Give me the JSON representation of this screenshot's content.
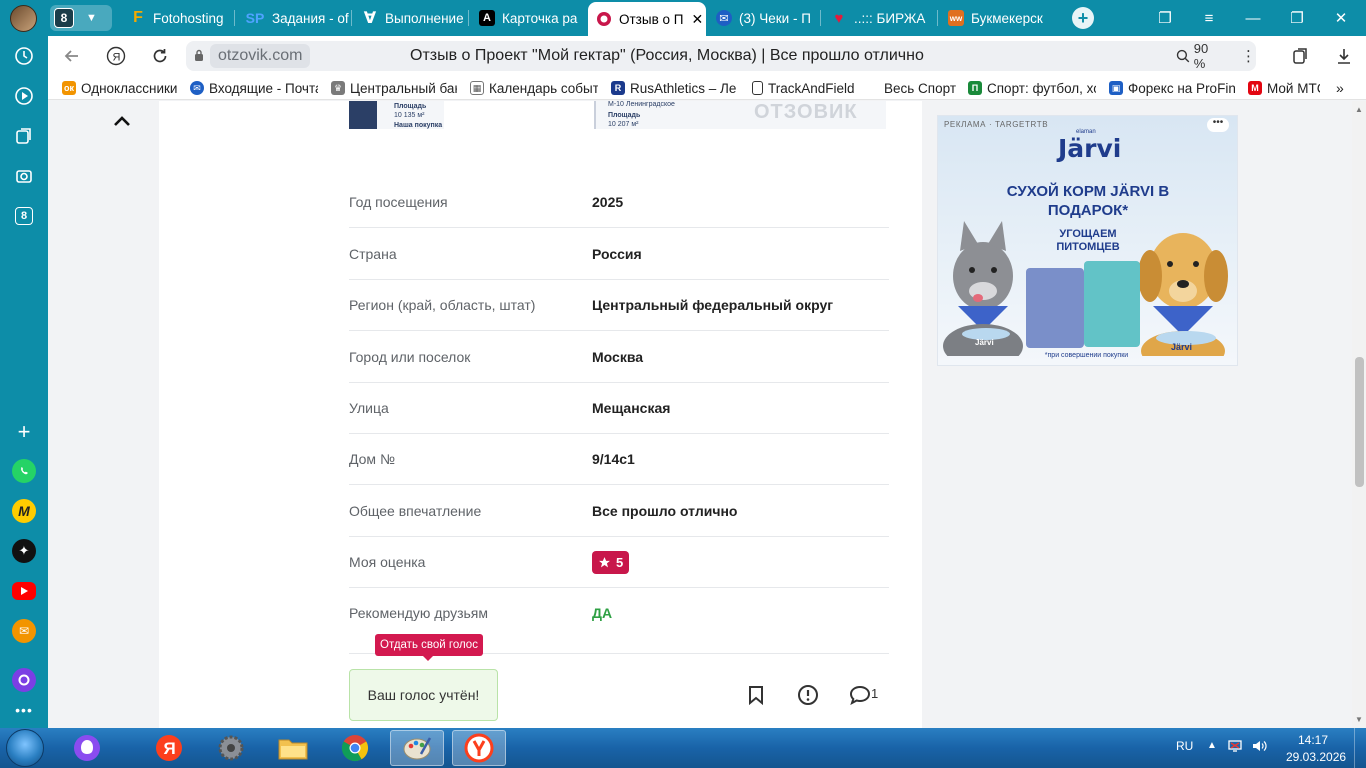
{
  "browser": {
    "tab_count": "8",
    "tabs": [
      {
        "label": "Fotohosting",
        "icon_letter": "F",
        "icon_color": "#f2a900"
      },
      {
        "label": "Задания - of",
        "icon_letter": "SP",
        "icon_color": "#1b74e4"
      },
      {
        "label": "Выполнение",
        "icon_letter": "∀",
        "icon_color": "#ffffff"
      },
      {
        "label": "Карточка ра",
        "icon_letter": "A",
        "icon_color": "#000000"
      },
      {
        "label": "Отзыв о П",
        "icon_letter": "",
        "icon_color": "#c8174b"
      },
      {
        "label": "(3) Чеки - П",
        "icon_letter": "✉",
        "icon_color": "#1e5fc4"
      },
      {
        "label": "..::: БИРЖА",
        "icon_letter": "♥",
        "icon_color": "#e21b3c"
      },
      {
        "label": "Букмекерск",
        "icon_letter": "ww",
        "icon_color": "#e07020"
      }
    ],
    "address": {
      "domain": "otzovik.com",
      "title": "Отзыв о Проект \"Мой гектар\" (Россия, Москва) | Все прошло отлично",
      "zoom": "90 %"
    },
    "bookmarks": [
      {
        "label": "Одноклассники",
        "color": "#f29400",
        "letter": "ок"
      },
      {
        "label": "Входящие - Почта",
        "color": "#1e5fc4",
        "letter": "✉"
      },
      {
        "label": "Центральный бан",
        "color": "#7a7a7a",
        "letter": "♛"
      },
      {
        "label": "Календарь событ",
        "color": "#555555",
        "letter": "▦"
      },
      {
        "label": "RusAthletics – Ле",
        "color": "#1b3a8c",
        "letter": "R"
      },
      {
        "label": "TrackAndField",
        "color": "#ffffff",
        "letter": "▯"
      },
      {
        "label": "Весь Спорт",
        "color": "#ffffff",
        "letter": ""
      },
      {
        "label": "Спорт: футбол, хо",
        "color": "#1a8a3a",
        "letter": "П"
      },
      {
        "label": "Форекс на ProFina",
        "color": "#1e5fc4",
        "letter": "▣"
      },
      {
        "label": "Мой МТС",
        "color": "#e30611",
        "letter": "М"
      }
    ]
  },
  "review": {
    "thumb1_lines": [
      "Площадь",
      "10 135 м²",
      "Наша покупка"
    ],
    "thumb2_lines": [
      "М-10 Ленинградское",
      "Площадь",
      "10 207 м²"
    ],
    "watermark": "ОТЗОВИК",
    "fields": [
      {
        "label": "Год посещения",
        "value": "2025"
      },
      {
        "label": "Страна",
        "value": "Россия"
      },
      {
        "label": "Регион (край, область, штат)",
        "value": "Центральный федеральный округ"
      },
      {
        "label": "Город или поселок",
        "value": "Москва"
      },
      {
        "label": "Улица",
        "value": "Мещанская"
      },
      {
        "label": "Дом №",
        "value": "9/14с1"
      },
      {
        "label": "Общее впечатление",
        "value": "Все прошло отлично"
      },
      {
        "label": "Моя оценка",
        "value": "5"
      },
      {
        "label": "Рекомендую друзьям",
        "value": "ДА"
      }
    ],
    "tooltip": "Отдать свой голос",
    "vote_status": "Ваш голос учтён!",
    "comments_count": "1"
  },
  "ad": {
    "label": "РЕКЛАМА · TARGETRTB",
    "brand_small": "elaman",
    "brand": "Järvi",
    "headline": "СУХОЙ КОРМ JÄRVI В ПОДАРОК*",
    "sub": "УГОЩАЕМ ПИТОМЦЕВ",
    "footnote": "*при совершении покупки",
    "bowl_left": "Järvi",
    "bowl_right": "Järvi"
  },
  "taskbar": {
    "lang": "RU",
    "time": "14:17",
    "date": "29.03.2026"
  }
}
